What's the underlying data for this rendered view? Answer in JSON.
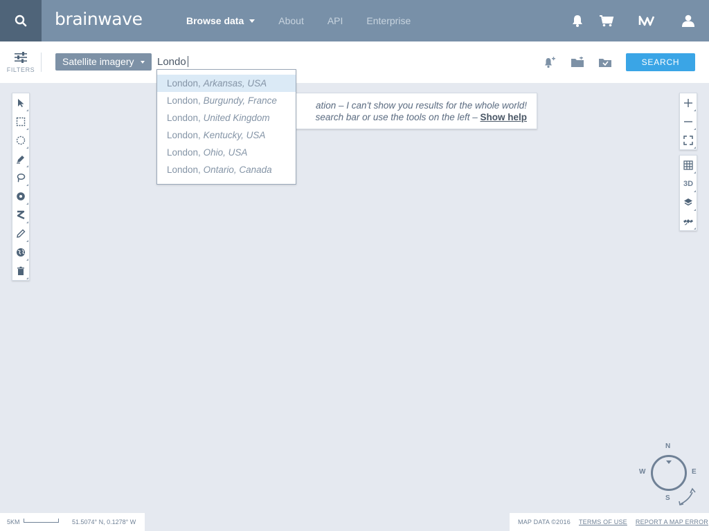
{
  "header": {
    "brand": "brainwave",
    "nav": [
      {
        "label": "Browse data",
        "active": true,
        "has_caret": true
      },
      {
        "label": "About"
      },
      {
        "label": "API"
      },
      {
        "label": "Enterprise"
      }
    ],
    "icons": [
      "search-icon",
      "bell-icon",
      "cart-icon",
      "brand-mark-icon",
      "user-icon"
    ]
  },
  "filterbar": {
    "filters_label": "FILTERS",
    "imagery_select": "Satellite imagery",
    "search_value": "Londo",
    "search_button": "SEARCH",
    "action_icons": [
      "add-alert-icon",
      "save-search-icon",
      "saved-searches-icon"
    ]
  },
  "autocomplete": [
    {
      "city": "London,",
      "place": "Arkansas, USA",
      "highlighted": true
    },
    {
      "city": "London,",
      "place": "Burgundy, France"
    },
    {
      "city": "London,",
      "place": "United Kingdom"
    },
    {
      "city": "London,",
      "place": "Kentucky, USA"
    },
    {
      "city": "London,",
      "place": "Ohio, USA"
    },
    {
      "city": "London,",
      "place": "Ontario, Canada"
    }
  ],
  "notice": {
    "line1": "ation – I can't show you results for the whole world!",
    "line2": "search bar or use the tools on the left –",
    "help_link": "Show help"
  },
  "left_tools": [
    "pointer-icon",
    "rectangle-select-icon",
    "circle-select-icon",
    "pen-icon",
    "lasso-icon",
    "point-radius-icon",
    "route-icon",
    "pencil-icon",
    "globe-icon",
    "trash-icon"
  ],
  "right_tools": {
    "zoom": [
      "zoom-in-icon",
      "zoom-out-icon",
      "fullscreen-icon"
    ],
    "view": [
      "grid-icon",
      "3d-label",
      "layers-icon",
      "satellite-icon"
    ],
    "three_d_label": "3D"
  },
  "compass": {
    "n": "N",
    "e": "E",
    "s": "S",
    "w": "W"
  },
  "footer": {
    "scale": "5KM",
    "coordinates": "51.5074° N, 0.1278° W",
    "map_data": "MAP DATA ©2016",
    "terms": "TERMS OF USE",
    "report": "REPORT A MAP ERROR"
  },
  "colors": {
    "header_bg": "#7890a8",
    "search_btn_bg": "#4f6479",
    "accent": "#3aa5e6",
    "map_bg": "#e5e9f0",
    "highlight_row": "#dbeaf6"
  }
}
